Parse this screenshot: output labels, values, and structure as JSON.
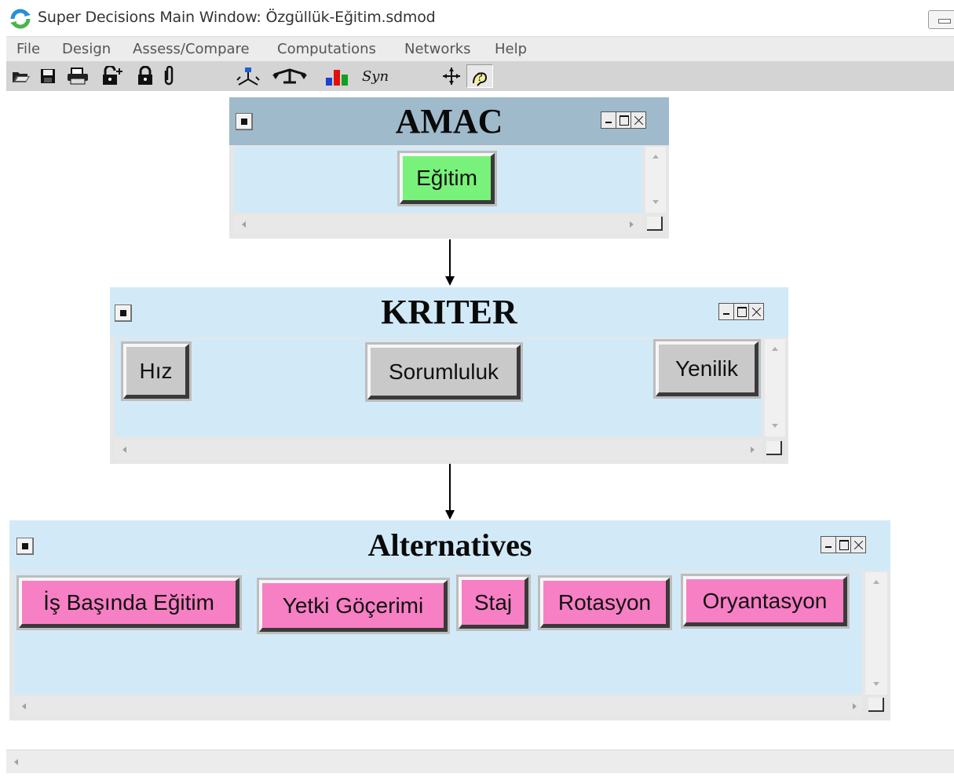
{
  "window": {
    "title": "Super Decisions Main Window: Özgüllük-Eğitim.sdmod"
  },
  "menu": [
    "File",
    "Design",
    "Assess/Compare",
    "Computations",
    "Networks",
    "Help"
  ],
  "toolbar": {
    "syn_label": "Syn"
  },
  "clusters": {
    "goal": {
      "name": "AMAC",
      "nodes": [
        "Eğitim"
      ]
    },
    "criteria": {
      "name": "KRITER",
      "nodes": [
        "Hız",
        "Sorumluluk",
        "Yenilik"
      ]
    },
    "alternatives": {
      "name": "Alternatives",
      "nodes": [
        "İş Başında Eğitim",
        "Yetki Göçerimi",
        "Staj",
        "Rotasyon",
        "Oryantasyon"
      ]
    }
  },
  "colors": {
    "goal_node": "#78f27a",
    "criteria_node": "#c9c9c9",
    "alternative_node": "#f77fc4",
    "cluster_body": "#d2eaf8",
    "goal_header": "#9fbacb"
  }
}
